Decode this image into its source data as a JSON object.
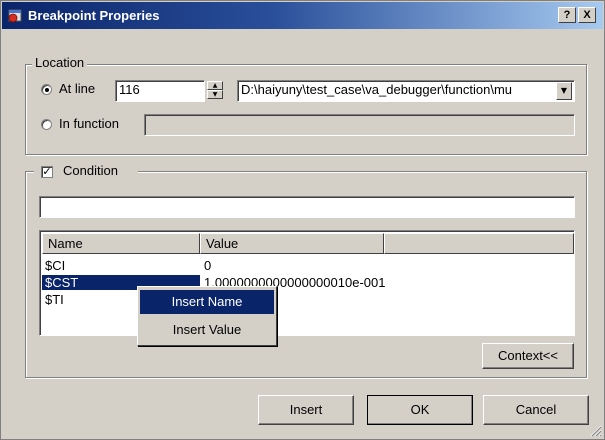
{
  "window": {
    "title": "Breakpoint Properies",
    "help_button": "?",
    "close_button": "X"
  },
  "location": {
    "group_label": "Location",
    "at_line_label": "At line",
    "at_line_selected": true,
    "line_value": "116",
    "file_value": "D:\\haiyuny\\test_case\\va_debugger\\function\\mu",
    "in_function_label": "In function",
    "in_function_value": ""
  },
  "condition": {
    "group_label": "Condition",
    "enabled": true,
    "expression_value": "",
    "columns": [
      "Name",
      "Value",
      ""
    ],
    "rows": [
      {
        "name": "$CI",
        "value": "0",
        "selected": false
      },
      {
        "name": "$CST",
        "value": "1.0000000000000000010e-001",
        "selected": true
      },
      {
        "name": "$TI",
        "value": "",
        "selected": false
      }
    ],
    "context_button": "Context<<"
  },
  "context_menu": {
    "items": [
      {
        "label": "Insert Name",
        "highlighted": true
      },
      {
        "label": "Insert Value",
        "highlighted": false
      }
    ]
  },
  "buttons": {
    "insert": "Insert",
    "ok": "OK",
    "cancel": "Cancel"
  },
  "icons": {
    "app": "breakpoint-app-icon",
    "spin_up": "spin-up-icon",
    "spin_down": "spin-down-icon",
    "dropdown": "dropdown-arrow-icon",
    "checkbox": "checkmark-icon",
    "grip": "resize-grip-icon"
  },
  "colors": {
    "selection": "#0a246a",
    "face": "#d4d0c8"
  }
}
